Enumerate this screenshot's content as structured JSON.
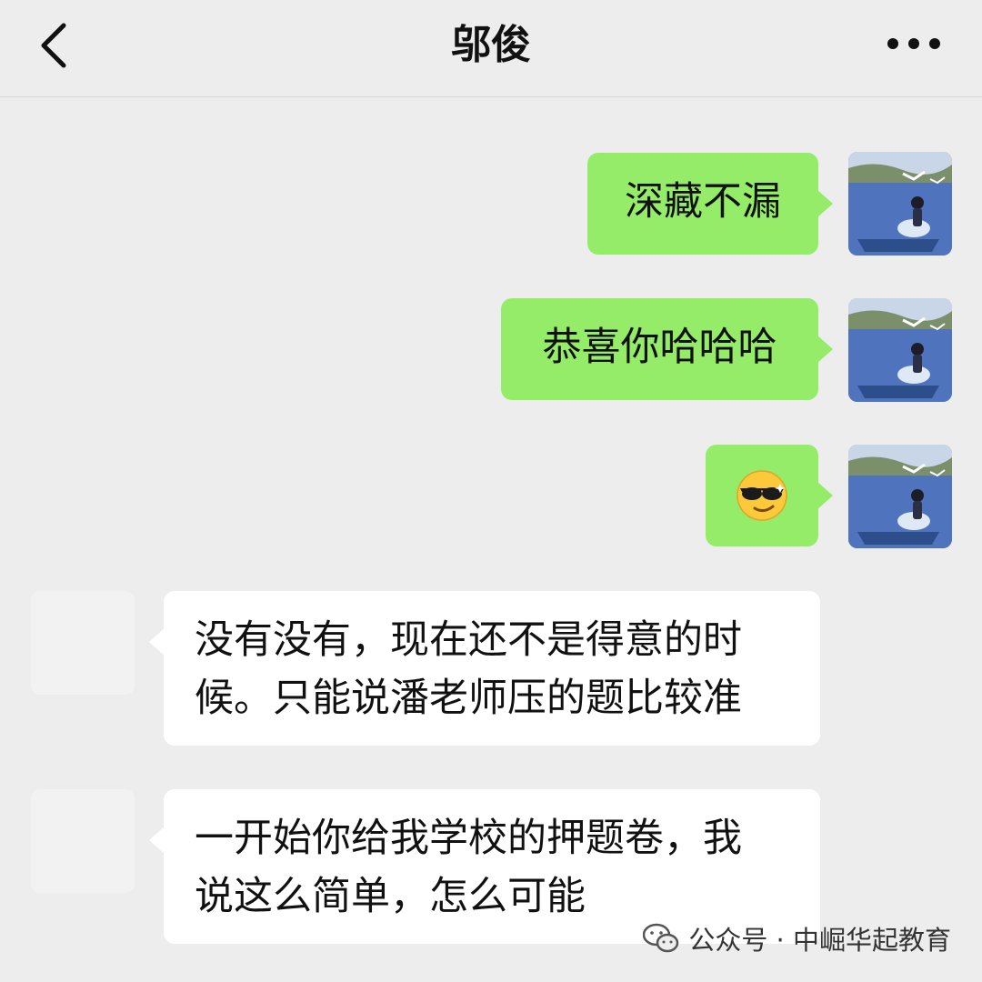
{
  "header": {
    "title": "邬俊",
    "back_icon": "chevron-left-icon",
    "more_icon": "more-dots-icon"
  },
  "messages": [
    {
      "side": "sent",
      "text": "深藏不漏"
    },
    {
      "side": "sent",
      "text": "恭喜你哈哈哈"
    },
    {
      "side": "sent",
      "emoji": "smiling-face-with-sunglasses"
    },
    {
      "side": "received",
      "lines": [
        "没有没有，现在还不是得意的时",
        "候。只能说潘老师压的题比较准"
      ]
    },
    {
      "side": "received",
      "lines": [
        "一开始你给我学校的押题卷，我",
        "说这么简单，怎么可能"
      ]
    }
  ],
  "watermark": {
    "text": "公众号 · 中崛华起教育",
    "icon": "wechat-logo-icon"
  },
  "colors": {
    "background": "#ededed",
    "sent_bubble": "#95ec69",
    "received_bubble": "#ffffff"
  }
}
